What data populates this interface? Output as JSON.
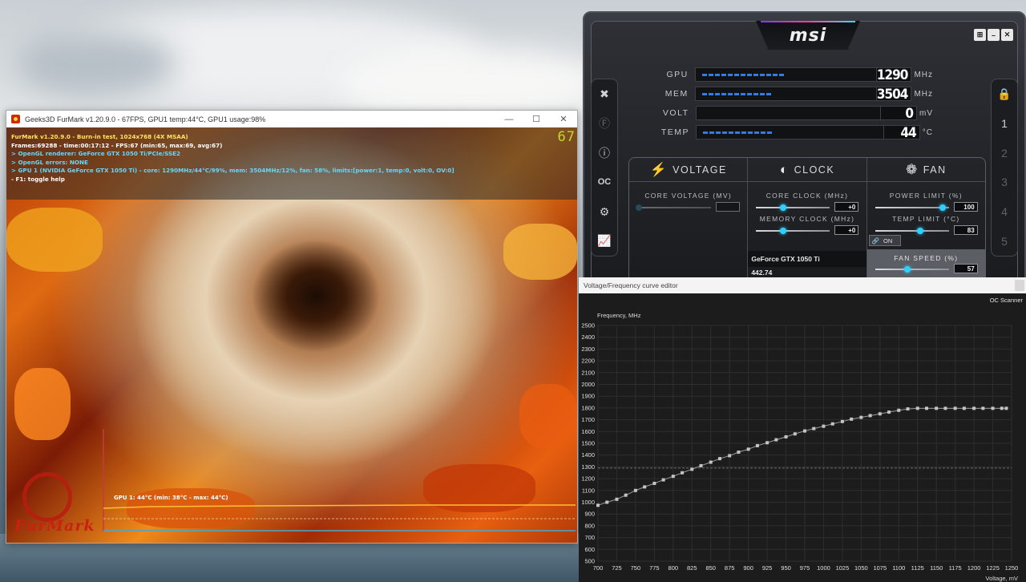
{
  "furmark": {
    "window_title": "Geeks3D FurMark v1.20.9.0 - 67FPS, GPU1 temp:44°C, GPU1 usage:98%",
    "fps_counter": "67",
    "osd": {
      "line1": "FurMark v1.20.9.0 - Burn-in test, 1024x768 (4X MSAA)",
      "line2": "Frames:69288 - time:00:17:12 - FPS:67 (min:65, max:69, avg:67)",
      "line3": "> OpenGL renderer: GeForce GTX 1050 Ti/PCIe/SSE2",
      "line4": "> OpenGL errors: NONE",
      "line5": "> GPU 1 (NVIDIA GeForce GTX 1050 Ti) - core: 1290MHz/44°C/99%, mem: 3504MHz/12%, fan: 58%, limits:[power:1, temp:0, volt:0, OV:0]",
      "line6": "- F1: toggle help"
    },
    "temp_graph_label": "GPU 1: 44°C (min: 38°C - max: 44°C)",
    "logo_text": "FurMark"
  },
  "afterburner": {
    "logo": "msi",
    "monitor": [
      {
        "label": "GPU",
        "value": "1290",
        "unit": "MHz",
        "fill": 0.47
      },
      {
        "label": "MEM",
        "value": "3504",
        "unit": "MHz",
        "fill": 0.4
      },
      {
        "label": "VOLT",
        "value": "0",
        "unit": "mV",
        "fill": 0
      },
      {
        "label": "TEMP",
        "value": "44",
        "unit": "°C",
        "fill": 0.4
      }
    ],
    "panels": {
      "voltage": {
        "title": "VOLTAGE",
        "core_voltage_label": "CORE VOLTAGE  (MV)",
        "core_voltage_value": ""
      },
      "clock": {
        "title": "CLOCK",
        "core_clock_label": "CORE CLOCK  (MHz)",
        "core_clock_value": "+0",
        "memory_clock_label": "MEMORY CLOCK  (MHz)",
        "memory_clock_value": "+0",
        "gpu_name": "GeForce GTX 1050 Ti",
        "driver": "442.74"
      },
      "fan": {
        "title": "FAN",
        "power_limit_label": "POWER LIMIT  (%)",
        "power_limit_value": "100",
        "temp_limit_label": "TEMP LIMIT  (°C)",
        "temp_limit_value": "83",
        "link_toggle": "ON",
        "fan_speed_label": "FAN SPEED  (%)",
        "fan_speed_value": "57"
      }
    },
    "profiles": [
      "1",
      "2",
      "3",
      "4",
      "5"
    ]
  },
  "vf_editor": {
    "window_title": "Voltage/Frequency curve editor",
    "oc_scanner": "OC Scanner",
    "chart_data": {
      "type": "line",
      "xlabel": "Voltage, mV",
      "ylabel": "Frequency, MHz",
      "xlim": [
        700,
        1250
      ],
      "ylim": [
        500,
        2500
      ],
      "x_ticks": [
        700,
        725,
        750,
        775,
        800,
        825,
        850,
        875,
        900,
        925,
        950,
        975,
        1000,
        1025,
        1050,
        1075,
        1100,
        1125,
        1150,
        1175,
        1200,
        1225,
        1250
      ],
      "y_ticks": [
        500,
        600,
        700,
        800,
        900,
        1000,
        1100,
        1200,
        1300,
        1400,
        1500,
        1600,
        1700,
        1800,
        1900,
        2000,
        2100,
        2200,
        2300,
        2400,
        2500
      ],
      "reference_line_y": 1290,
      "series": [
        {
          "x": [
            700,
            712,
            725,
            737,
            750,
            762,
            775,
            787,
            800,
            812,
            825,
            837,
            850,
            862,
            875,
            887,
            900,
            912,
            925,
            937,
            950,
            962,
            975,
            987,
            1000,
            1012,
            1025,
            1037,
            1050,
            1062,
            1075,
            1087,
            1100,
            1112,
            1125,
            1137,
            1150,
            1162,
            1175,
            1187,
            1200,
            1212,
            1225,
            1237,
            1243
          ],
          "y": [
            974,
            1000,
            1025,
            1060,
            1100,
            1130,
            1160,
            1190,
            1220,
            1250,
            1280,
            1310,
            1340,
            1370,
            1395,
            1425,
            1450,
            1480,
            1505,
            1530,
            1555,
            1580,
            1605,
            1625,
            1645,
            1665,
            1685,
            1705,
            1720,
            1735,
            1750,
            1765,
            1780,
            1792,
            1797,
            1797,
            1797,
            1797,
            1797,
            1797,
            1797,
            1797,
            1797,
            1797,
            1797
          ]
        }
      ]
    }
  },
  "colors": {
    "osd_yellow": "#ffe65a",
    "osd_cyan": "#63d8ff",
    "msi_accent": "#2ed0ff",
    "fps_green": "#c7d631"
  }
}
